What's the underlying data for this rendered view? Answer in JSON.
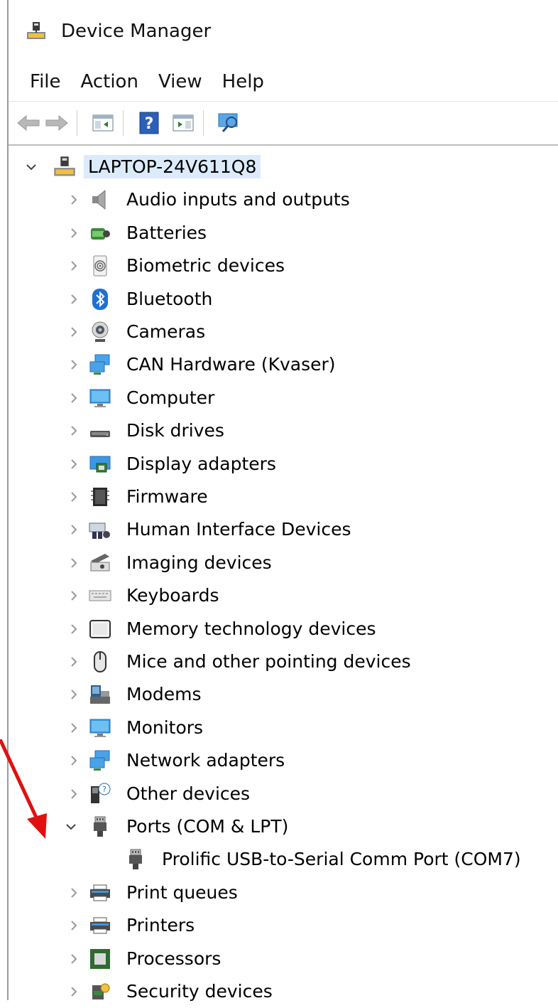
{
  "window": {
    "title": "Device Manager"
  },
  "menu": [
    "File",
    "Action",
    "View",
    "Help"
  ],
  "tree": {
    "root": "LAPTOP-24V611Q8",
    "items": [
      {
        "label": "Audio inputs and outputs",
        "icon": "speaker-icon",
        "expanded": false
      },
      {
        "label": "Batteries",
        "icon": "battery-icon",
        "expanded": false
      },
      {
        "label": "Biometric devices",
        "icon": "fingerprint-icon",
        "expanded": false
      },
      {
        "label": "Bluetooth",
        "icon": "bluetooth-icon",
        "expanded": false
      },
      {
        "label": "Cameras",
        "icon": "camera-icon",
        "expanded": false
      },
      {
        "label": "CAN Hardware (Kvaser)",
        "icon": "network-icon",
        "expanded": false
      },
      {
        "label": "Computer",
        "icon": "monitor-icon",
        "expanded": false
      },
      {
        "label": "Disk drives",
        "icon": "disk-icon",
        "expanded": false
      },
      {
        "label": "Display adapters",
        "icon": "display-adapter-icon",
        "expanded": false
      },
      {
        "label": "Firmware",
        "icon": "chip-icon",
        "expanded": false
      },
      {
        "label": "Human Interface Devices",
        "icon": "hid-icon",
        "expanded": false
      },
      {
        "label": "Imaging devices",
        "icon": "scanner-icon",
        "expanded": false
      },
      {
        "label": "Keyboards",
        "icon": "keyboard-icon",
        "expanded": false
      },
      {
        "label": "Memory technology devices",
        "icon": "memory-icon",
        "expanded": false
      },
      {
        "label": "Mice and other pointing devices",
        "icon": "mouse-icon",
        "expanded": false
      },
      {
        "label": "Modems",
        "icon": "modem-icon",
        "expanded": false
      },
      {
        "label": "Monitors",
        "icon": "monitor-icon",
        "expanded": false
      },
      {
        "label": "Network adapters",
        "icon": "network-icon",
        "expanded": false
      },
      {
        "label": "Other devices",
        "icon": "unknown-device-icon",
        "expanded": false
      },
      {
        "label": "Ports (COM & LPT)",
        "icon": "port-icon",
        "expanded": true
      },
      {
        "label": "Prolific USB-to-Serial Comm Port (COM7)",
        "icon": "port-icon",
        "child": true
      },
      {
        "label": "Print queues",
        "icon": "printer-icon",
        "expanded": false
      },
      {
        "label": "Printers",
        "icon": "printer-icon",
        "expanded": false
      },
      {
        "label": "Processors",
        "icon": "processor-icon",
        "expanded": false
      },
      {
        "label": "Security devices",
        "icon": "security-icon",
        "expanded": false
      }
    ]
  },
  "colors": {
    "selection": "#dcebfc",
    "annotation_arrow": "#e01010"
  }
}
